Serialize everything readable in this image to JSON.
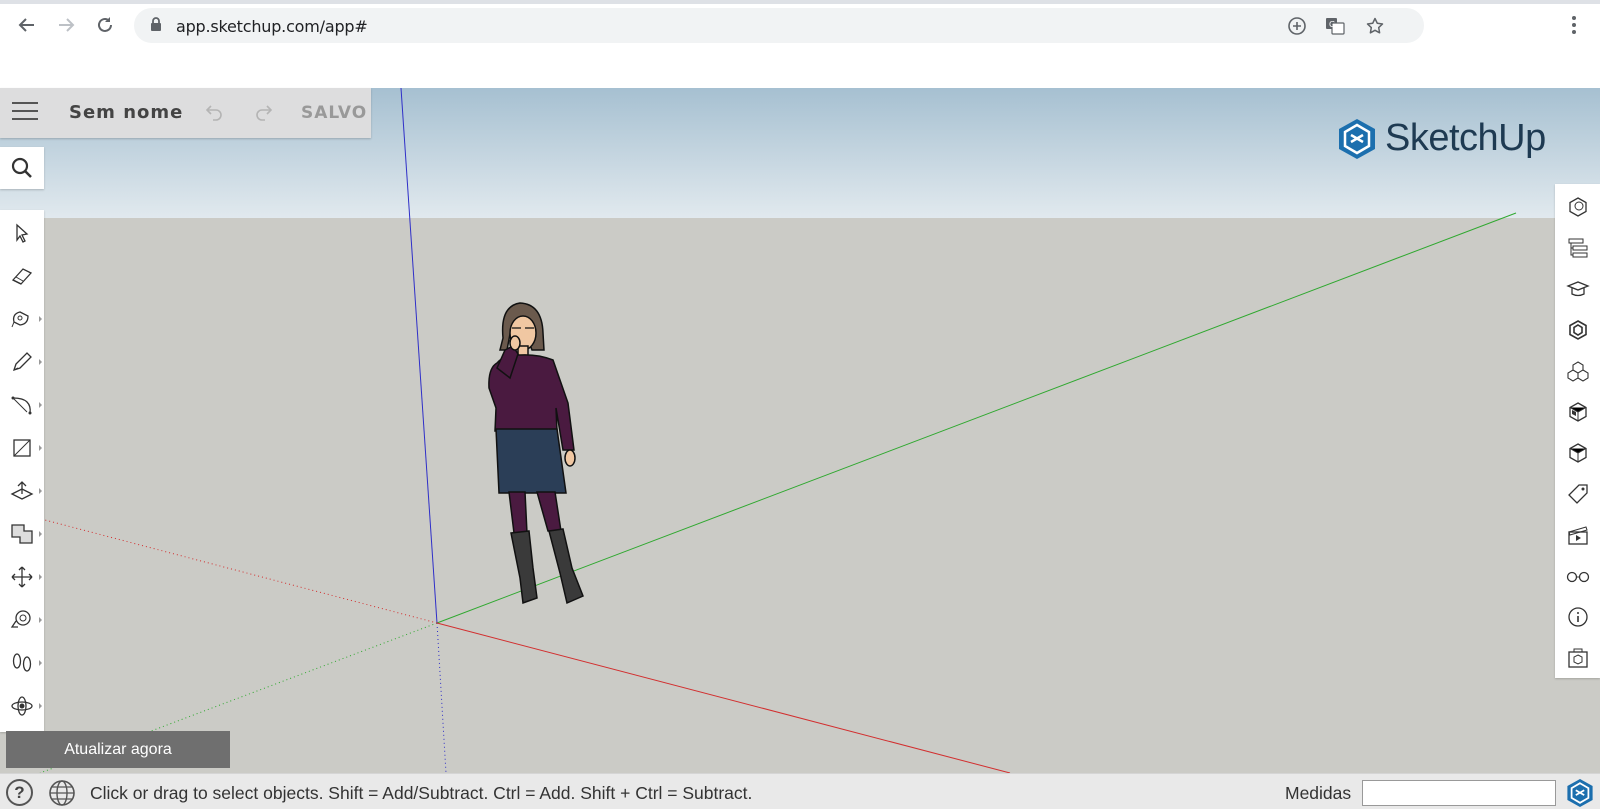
{
  "browser": {
    "url": "app.sketchup.com/app#"
  },
  "file_bar": {
    "file_name": "Sem nome",
    "save_status": "SALVO"
  },
  "brand": {
    "logo_text": "SketchUp",
    "accent_color": "#1c6fae"
  },
  "left_toolbar": {
    "tools": [
      "select",
      "eraser",
      "paint-bucket",
      "pencil",
      "arc",
      "rectangle",
      "push-pull",
      "offset",
      "move",
      "tape-measure",
      "walk",
      "orbit"
    ]
  },
  "right_toolbar": {
    "panels": [
      "entity-info",
      "outliner",
      "instructor",
      "components",
      "materials",
      "styles",
      "tags",
      "scenes",
      "display",
      "model-info",
      "3d-warehouse"
    ]
  },
  "update_button": {
    "label": "Atualizar agora"
  },
  "status_bar": {
    "hint": "Click or drag to select objects. Shift = Add/Subtract. Ctrl = Add. Shift + Ctrl = Subtract.",
    "measure_label": "Medidas",
    "measure_value": ""
  },
  "axes_colors": {
    "red": "#d22f2f",
    "green": "#2fa82f",
    "blue": "#2f2fc8"
  }
}
